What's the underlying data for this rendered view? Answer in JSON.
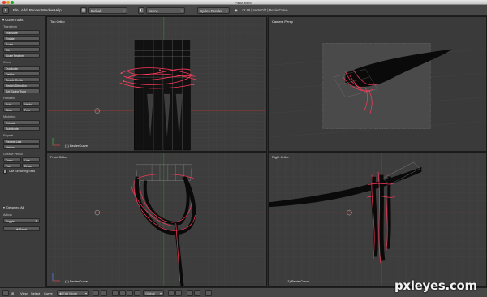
{
  "window": {
    "title": "Pasta.blend"
  },
  "header": {
    "menus": [
      "File",
      "Add",
      "Render",
      "Window",
      "Help"
    ],
    "layout": "Default",
    "scene": "Scene",
    "engine": "Cycles Render",
    "stats": "v2.69 | Verts:0/7 | BezierCurve"
  },
  "toolshelf": {
    "title": "Curve Tools",
    "sections": {
      "transform": "Transform",
      "curve": "Curve",
      "handles": "Handles",
      "modeling": "Modeling",
      "repeat": "Repeat",
      "grease": "Grease Pencil"
    },
    "buttons": {
      "translate": "Translate",
      "rotate": "Rotate",
      "scale": "Scale",
      "tilt": "Tilt",
      "scale_feather": "Scale Feather",
      "duplicate": "Duplicate",
      "delete": "Delete",
      "toggle_cyclic": "Toggle Cyclic",
      "switch_direction": "Switch Direction",
      "set_spline_type": "Set Spline Type",
      "auto": "Auto",
      "vector": "Vector",
      "align": "Align",
      "free": "Free",
      "extrude": "Extrude",
      "subdivide": "Subdivide",
      "repeat_last": "Repeat Last",
      "history": "History...",
      "draw": "Draw",
      "line": "Line",
      "poly": "Poly",
      "erase": "Erase"
    },
    "checkbox": {
      "label": "Use Sketching Sess"
    },
    "operator": {
      "title": "(De)select All",
      "action_label": "Action",
      "action_value": "Toggle",
      "reset": "Reset"
    }
  },
  "viewports": {
    "top": {
      "label": "Top Ortho",
      "object": "(1) BezierCurve"
    },
    "camera": {
      "label": "Camera Persp"
    },
    "front": {
      "label": "Front Ortho",
      "object": "(1) BezierCurve"
    },
    "right": {
      "label": "Right Ortho",
      "object": "(1) BezierCurve"
    }
  },
  "bottom": {
    "view": "View",
    "select": "Select",
    "curve": "Curve",
    "mode": "Edit Mode",
    "pivot": "Global"
  },
  "watermark": "pxleyes.com",
  "colors": {
    "curve_select": "#ff3a5a",
    "curve_dark": "#0a0a0a",
    "grid": "#474747",
    "axis_green": "#3ea83e",
    "axis_red": "#b23a3a"
  }
}
